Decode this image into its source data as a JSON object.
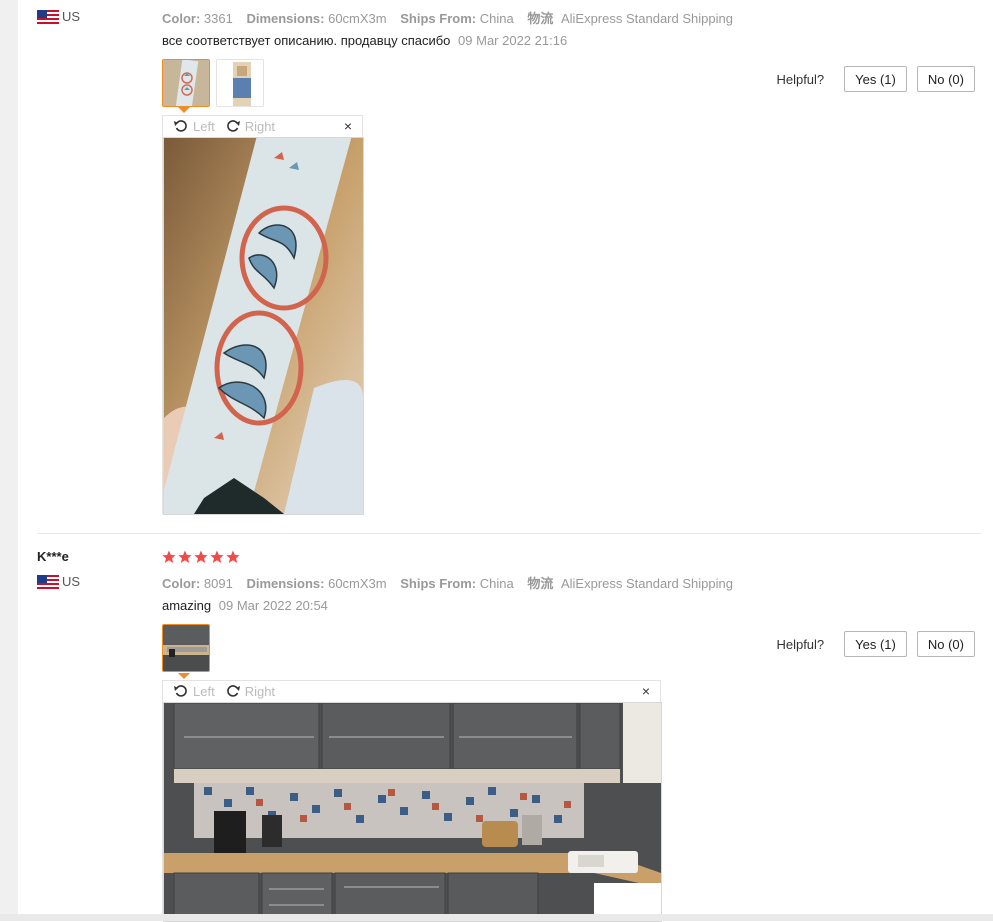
{
  "reviews": [
    {
      "username": "",
      "country": "US",
      "attributes": {
        "color_key": "Color:",
        "color_val": "3361",
        "dim_key": "Dimensions:",
        "dim_val": "60cmX3m",
        "ships_key": "Ships From:",
        "ships_val": "China",
        "logistics_key": "物流",
        "logistics_val": "AliExpress Standard Shipping"
      },
      "comment": "все соответствует описанию. продавцу спасибо",
      "date": "09 Mar 2022 21:16",
      "helpful_label": "Helpful?",
      "yes_label": "Yes (1)",
      "no_label": "No (0)",
      "viewer": {
        "left_label": "Left",
        "right_label": "Right",
        "close_label": "×"
      }
    },
    {
      "username": "K***e",
      "country": "US",
      "stars": 5,
      "attributes": {
        "color_key": "Color:",
        "color_val": "8091",
        "dim_key": "Dimensions:",
        "dim_val": "60cmX3m",
        "ships_key": "Ships From:",
        "ships_val": "China",
        "logistics_key": "物流",
        "logistics_val": "AliExpress Standard Shipping"
      },
      "comment": "amazing",
      "date": "09 Mar 2022 20:54",
      "helpful_label": "Helpful?",
      "yes_label": "Yes (1)",
      "no_label": "No (0)",
      "viewer": {
        "left_label": "Left",
        "right_label": "Right",
        "close_label": "×"
      }
    }
  ],
  "colors": {
    "accent": "#f08c27",
    "star": "#f04a4a",
    "muted": "#999999"
  }
}
